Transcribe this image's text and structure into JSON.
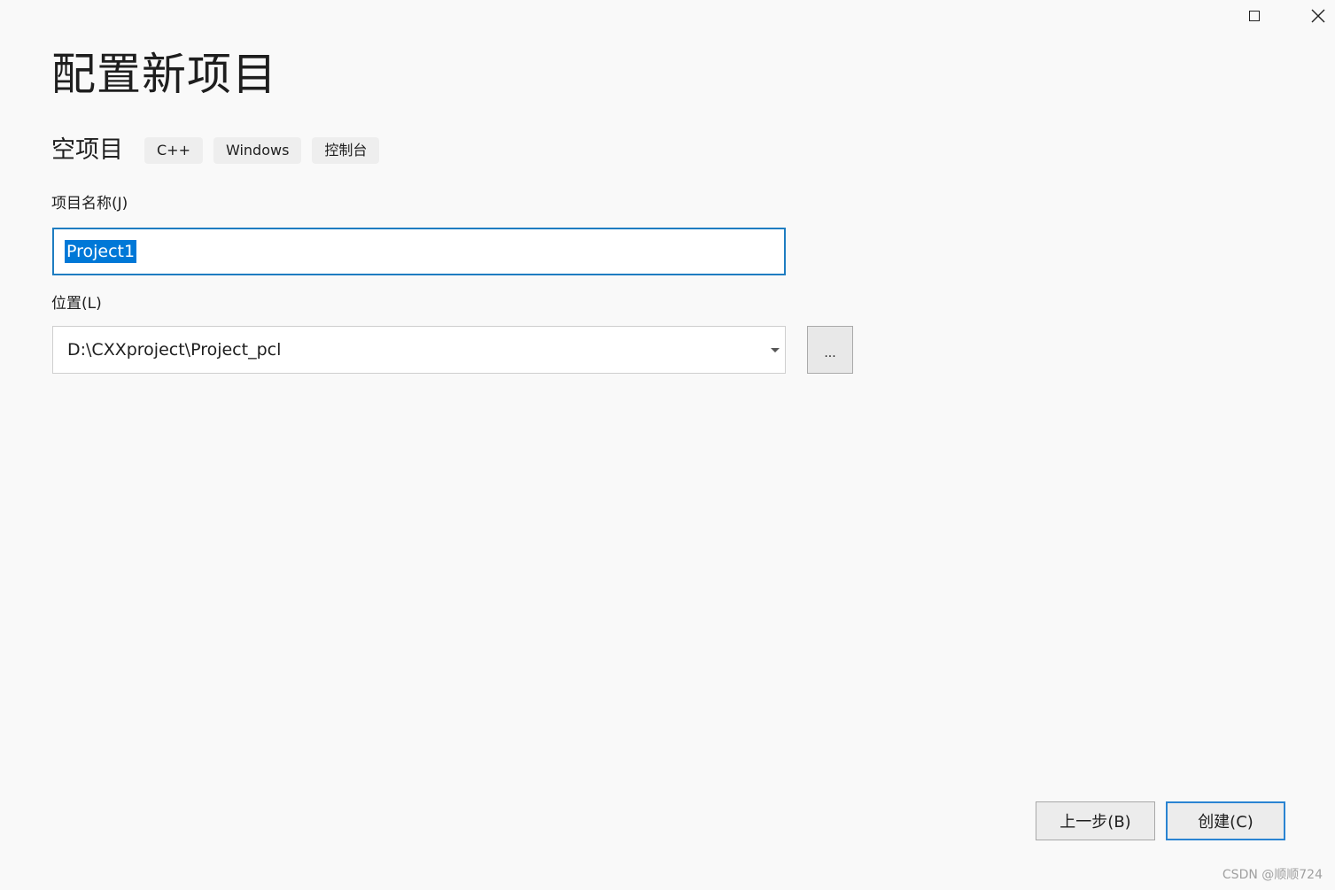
{
  "window": {
    "maximize_icon": "maximize-icon",
    "close_icon": "close-icon",
    "accent_color": "#1f7dc1",
    "selection_color": "#0078d7"
  },
  "header": {
    "title": "配置新项目"
  },
  "template": {
    "name": "空项目",
    "tags": [
      "C++",
      "Windows",
      "控制台"
    ]
  },
  "project_name": {
    "label": "项目名称(J)",
    "value": "Project1"
  },
  "location": {
    "label": "位置(L)",
    "value": "D:\\CXXproject\\Project_pcl",
    "browse_label": "..."
  },
  "footer": {
    "back_label": "上一步(B)",
    "create_label": "创建(C)"
  },
  "watermark": "CSDN @顺顺724"
}
